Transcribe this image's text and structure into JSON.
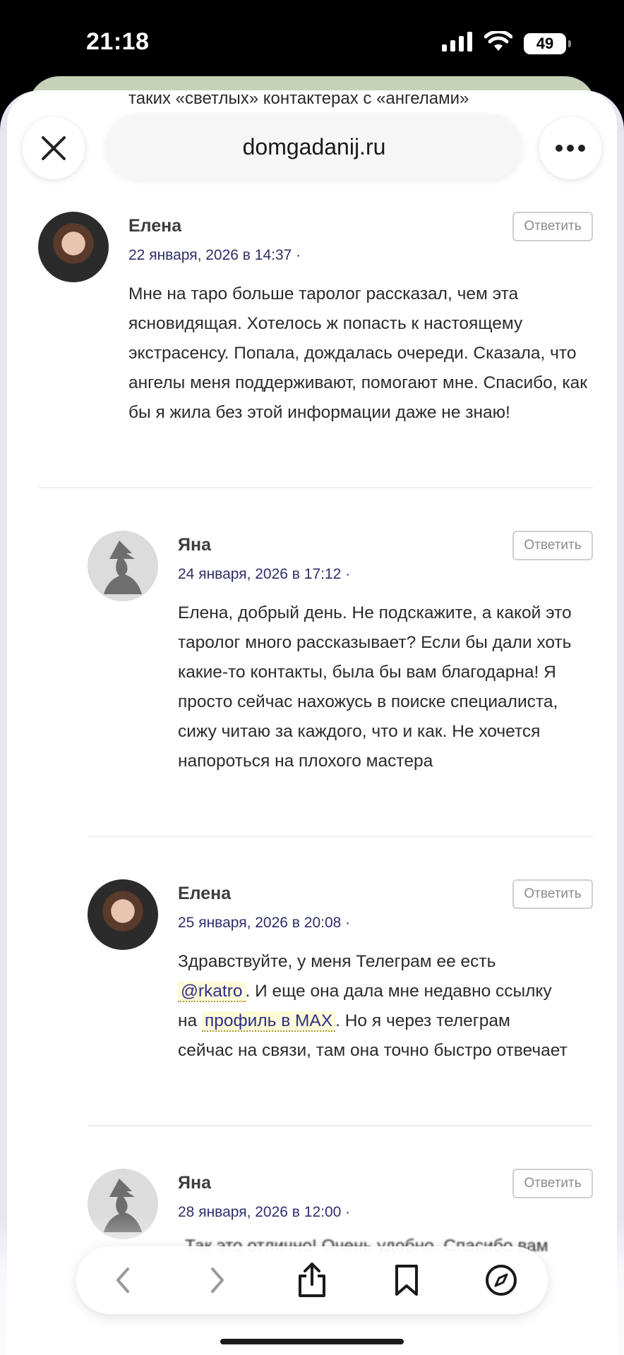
{
  "status": {
    "time": "21:18",
    "battery": "49"
  },
  "browser": {
    "url": "domgadanij.ru",
    "partial_top_text": "таких «светлых» контактерах с «ангелами»"
  },
  "comments": [
    {
      "author": "Елена",
      "date": "22 января, 2026 в 14:37 ·",
      "reply": "Ответить",
      "text": "Мне на таро больше таролог рассказал, чем эта ясновидящая. Хотелось ж попасть к настоящему экстрасенсу. Попала, дождалась очереди. Сказала, что ангелы меня поддерживают, помогают мне. Спасибо, как бы я жила без этой информации даже не знаю!"
    },
    {
      "author": "Яна",
      "date": "24 января, 2026 в 17:12 ·",
      "reply": "Ответить",
      "text": "Елена, добрый день. Не подскажите, а какой это таролог много рассказывает? Если бы дали хоть какие-то контакты, была бы вам благодарна! Я просто сейчас нахожусь в поиске специалиста, сижу читаю за каждого, что и как. Не хочется напороться на плохого мастера"
    },
    {
      "author": "Елена",
      "date": "25 января, 2026 в 20:08 ·",
      "reply": "Ответить",
      "text_line1": "Здравствуйте, у меня Телеграм ее есть",
      "mention": "@rkatro",
      "text_after_mention": ". И еще она дала мне недавно ссылку",
      "text_na": "на",
      "link": "профиль в MAX",
      "text_after_link": ". Но я через телеграм",
      "text_rest": "сейчас на связи, там она точно быстро отвечает"
    },
    {
      "author": "Яна",
      "date": "28 января, 2026 в 12:00 ·",
      "reply": "Ответить",
      "text_partial": "Так это отлично! Очень удобно. Спасибо вам"
    }
  ],
  "toolbar": {
    "icons": [
      "back-icon",
      "forward-icon",
      "share-icon",
      "bookmark-icon",
      "compass-icon"
    ]
  }
}
